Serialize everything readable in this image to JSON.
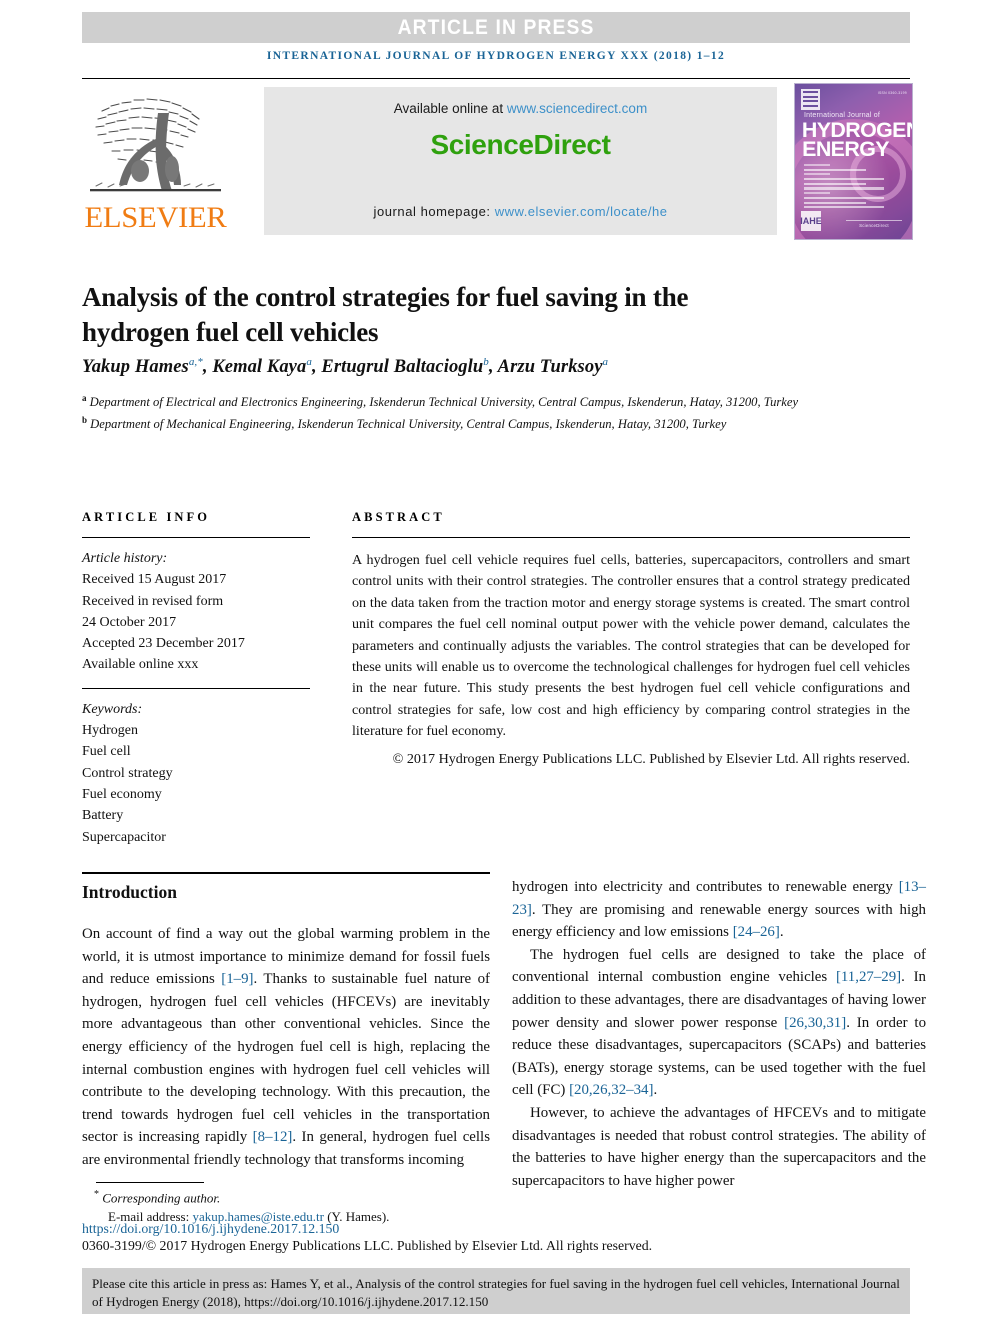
{
  "banner": {
    "article_in_press": "ARTICLE IN PRESS"
  },
  "running_head": "INTERNATIONAL JOURNAL OF HYDROGEN ENERGY XXX (2018) 1–12",
  "masthead": {
    "publisher_name": "ELSEVIER",
    "available_prefix": "Available online at ",
    "sciencedirect_url": "www.sciencedirect.com",
    "brand": "ScienceDirect",
    "homepage_label": "journal homepage: ",
    "homepage_url": "www.elsevier.com/locate/he",
    "cover": {
      "issn": "ISSN 0360-3199",
      "line_small": "International Journal of",
      "line1": "HYDROGEN",
      "line2": "ENERGY",
      "hex_badge": "IAHE",
      "footer_brand": "ScienceDirect"
    }
  },
  "article": {
    "title": "Analysis of the control strategies for fuel saving in the hydrogen fuel cell vehicles",
    "authors": [
      {
        "name": "Yakup Hames",
        "marks": "a,*"
      },
      {
        "name": "Kemal Kaya",
        "marks": "a"
      },
      {
        "name": "Ertugrul Baltacioglu",
        "marks": "b"
      },
      {
        "name": "Arzu Turksoy",
        "marks": "a"
      }
    ],
    "affiliations": [
      {
        "mark": "a",
        "text": "Department of Electrical and Electronics Engineering, Iskenderun Technical University, Central Campus, Iskenderun, Hatay, 31200, Turkey"
      },
      {
        "mark": "b",
        "text": "Department of Mechanical Engineering, Iskenderun Technical University, Central Campus, Iskenderun, Hatay, 31200, Turkey"
      }
    ]
  },
  "article_info": {
    "heading": "ARTICLE INFO",
    "history_label": "Article history:",
    "history": [
      "Received 15 August 2017",
      "Received in revised form",
      "24 October 2017",
      "Accepted 23 December 2017",
      "Available online xxx"
    ],
    "keywords_label": "Keywords:",
    "keywords": [
      "Hydrogen",
      "Fuel cell",
      "Control strategy",
      "Fuel economy",
      "Battery",
      "Supercapacitor"
    ]
  },
  "abstract": {
    "heading": "ABSTRACT",
    "text": "A hydrogen fuel cell vehicle requires fuel cells, batteries, supercapacitors, controllers and smart control units with their control strategies. The controller ensures that a control strategy predicated on the data taken from the traction motor and energy storage systems is created. The smart control unit compares the fuel cell nominal output power with the vehicle power demand, calculates the parameters and continually adjusts the variables. The control strategies that can be developed for these units will enable us to overcome the technological challenges for hydrogen fuel cell vehicles in the near future. This study presents the best hydrogen fuel cell vehicle configurations and control strategies for safe, low cost and high efficiency by comparing control strategies in the literature for fuel economy.",
    "copyright": "© 2017 Hydrogen Energy Publications LLC. Published by Elsevier Ltd. All rights reserved."
  },
  "body": {
    "section_title": "Introduction",
    "left_paragraph_parts": {
      "p1_a": "On account of find a way out the global warming problem in the world, it is utmost importance to minimize demand for fossil fuels and reduce emissions ",
      "p1_ref1": "[1–9]",
      "p1_b": ". Thanks to sustainable fuel nature of hydrogen, hydrogen fuel cell vehicles (HFCEVs) are inevitably more advantageous than other conventional vehicles. Since the energy efficiency of the hydrogen fuel cell is high, replacing the internal combustion engines with hydrogen fuel cell vehicles will contribute to the developing technology. With this precaution, the trend towards hydrogen fuel cell vehicles in the transportation sector is increasing rapidly ",
      "p1_ref2": "[8–12]",
      "p1_c": ". In general, hydrogen fuel cells are environmental friendly technology that transforms incoming"
    },
    "right_paragraph_parts": {
      "r1_a": "hydrogen into electricity and contributes to renewable energy ",
      "r1_ref1": "[13–23]",
      "r1_b": ". They are promising and renewable energy sources with high energy efficiency and low emissions ",
      "r1_ref2": "[24–26]",
      "r1_c": ".",
      "r2_a": "The hydrogen fuel cells are designed to take the place of conventional internal combustion engine vehicles ",
      "r2_ref1": "[11,27–29]",
      "r2_b": ". In addition to these advantages, there are disadvantages of having lower power density and slower power response ",
      "r2_ref2": "[26,30,31]",
      "r2_c": ". In order to reduce these disadvantages, supercapacitors (SCAPs) and batteries (BATs), energy storage systems, can be used together with the fuel cell (FC) ",
      "r2_ref3": "[20,26,32–34]",
      "r2_d": ".",
      "r3": "However, to achieve the advantages of HFCEVs and to mitigate disadvantages is needed that robust control strategies. The ability of the batteries to have higher energy than the supercapacitors and the supercapacitors to have higher power"
    }
  },
  "footer": {
    "corresponding_author": "Corresponding author.",
    "email_label": "E-mail address: ",
    "email": "yakup.hames@iste.edu.tr",
    "email_suffix": " (Y. Hames).",
    "doi": "https://doi.org/10.1016/j.ijhydene.2017.12.150",
    "issn_line": "0360-3199/© 2017 Hydrogen Energy Publications LLC. Published by Elsevier Ltd. All rights reserved.",
    "cite_box": "Please cite this article in press as: Hames Y, et al., Analysis of the control strategies for fuel saving in the hydrogen fuel cell vehicles, International Journal of Hydrogen Energy (2018), https://doi.org/10.1016/j.ijhydene.2017.12.150"
  },
  "colors": {
    "link_blue": "#1a6496",
    "sd_green": "#2fa10e",
    "elsevier_orange": "#f07c13",
    "band_gray": "#cfcfcf",
    "sd_box_gray": "#e6e6e6"
  }
}
